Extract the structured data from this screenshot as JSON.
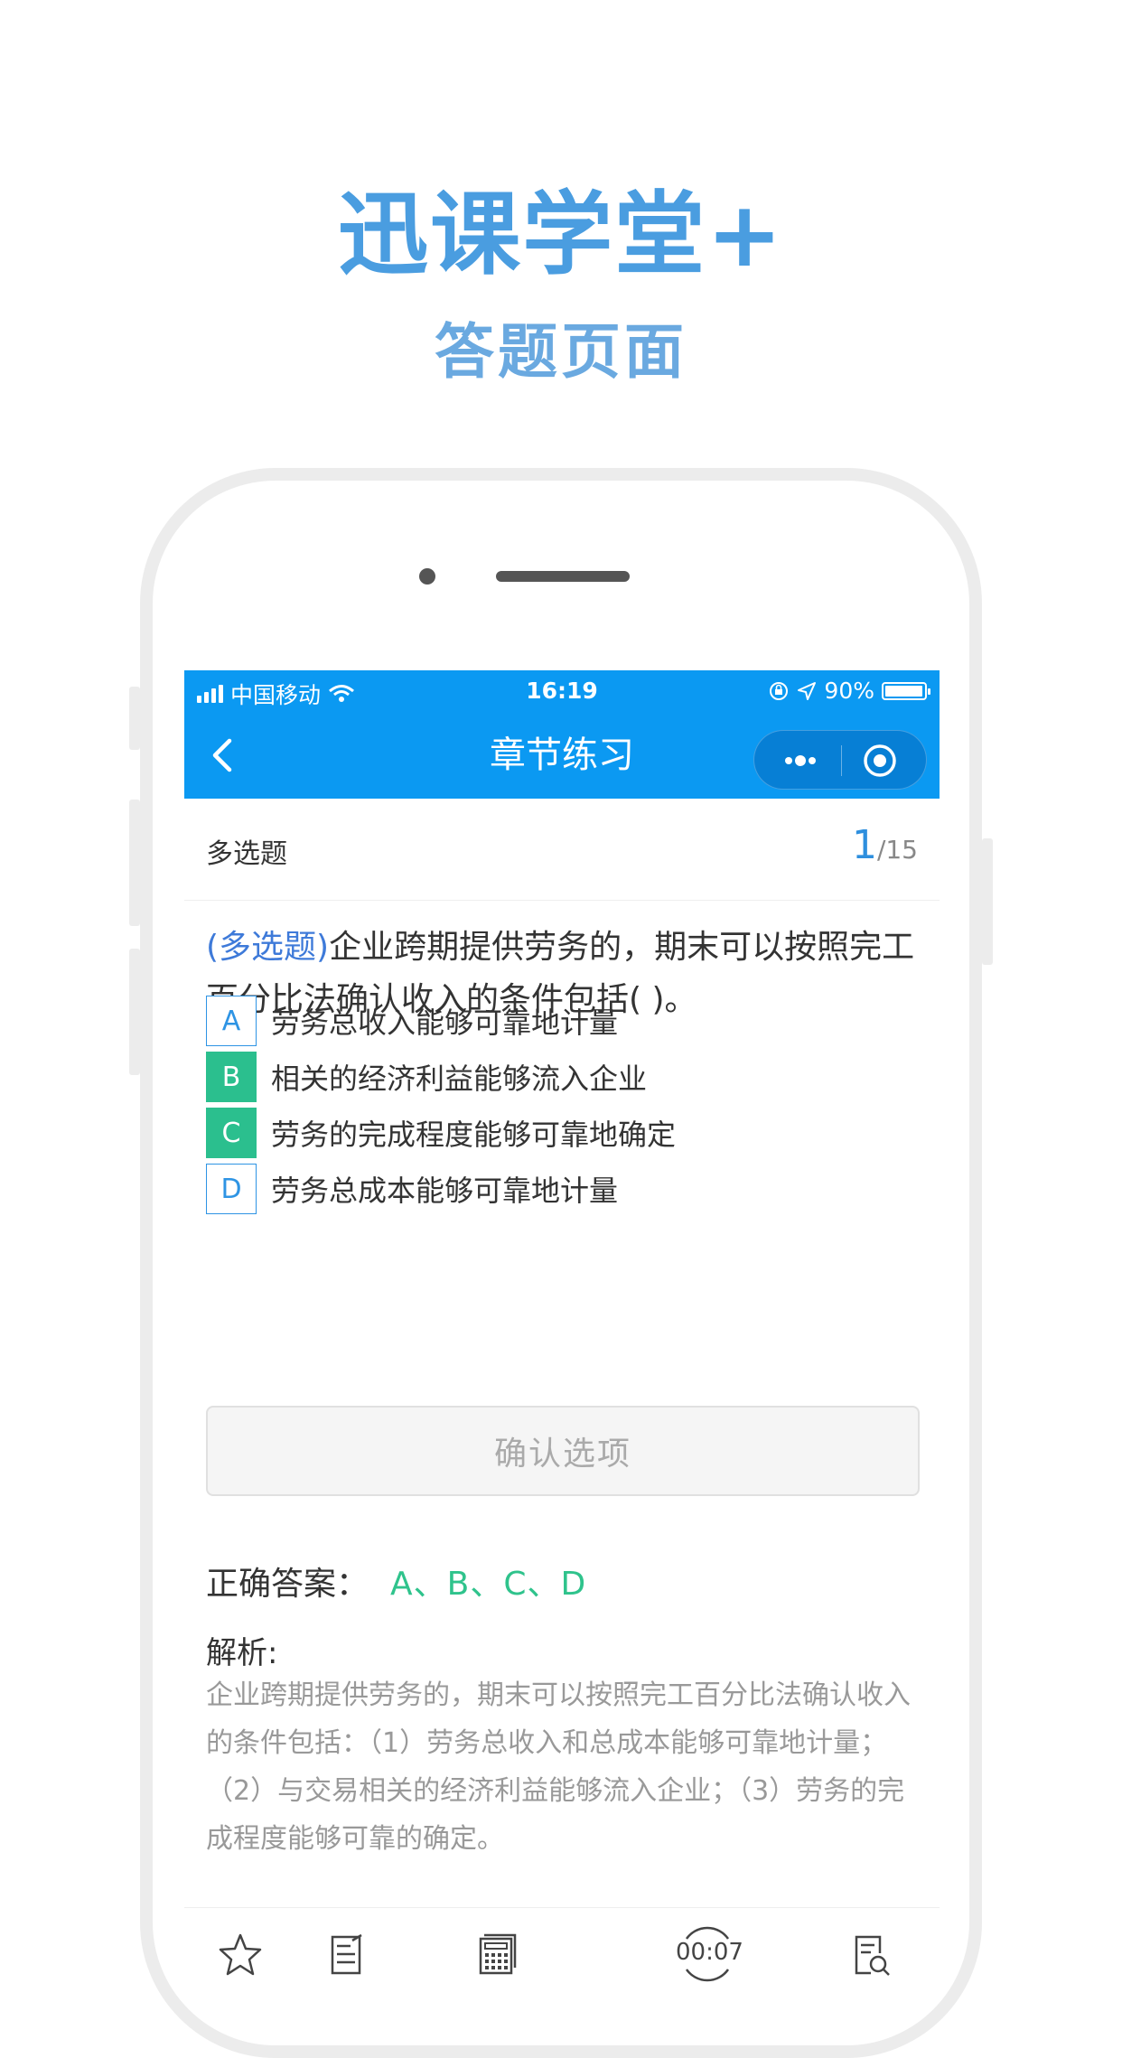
{
  "hero": {
    "title": "迅课学堂+",
    "subtitle": "答题页面"
  },
  "status_bar": {
    "carrier": "中国移动",
    "time": "16:19",
    "battery": "90%"
  },
  "nav": {
    "title": "章节练习"
  },
  "question_header": {
    "type": "多选题",
    "current": "1",
    "total": "/15"
  },
  "question": {
    "tag": "(多选题)",
    "text": "企业跨期提供劳务的，期末可以按照完工百分比法确认收入的条件包括( )。"
  },
  "options": [
    {
      "letter": "A",
      "text": "劳务总收入能够可靠地计量",
      "selected": false
    },
    {
      "letter": "B",
      "text": "相关的经济利益能够流入企业",
      "selected": true
    },
    {
      "letter": "C",
      "text": "劳务的完成程度能够可靠地确定",
      "selected": true
    },
    {
      "letter": "D",
      "text": "劳务总成本能够可靠地计量",
      "selected": false
    }
  ],
  "confirm_label": "确认选项",
  "answer": {
    "label": "正确答案：",
    "value": "A、B、C、D"
  },
  "analysis": {
    "title": "解析:",
    "text": "企业跨期提供劳务的，期末可以按照完工百分比法确认收入的条件包括：（1）劳务总收入和总成本能够可靠地计量；（2）与交易相关的经济利益能够流入企业；（3）劳务的完成程度能够可靠的确定。"
  },
  "toolbar": {
    "timer": "00:07"
  },
  "icons": [
    "signal-icon",
    "wifi-icon",
    "lock-rotation-icon",
    "location-icon",
    "battery-icon",
    "back-icon",
    "more-icon",
    "close-target-icon",
    "star-icon",
    "notes-icon",
    "calculator-icon",
    "timer-icon",
    "search-doc-icon"
  ],
  "colors": {
    "nav_blue": "#0b99f2",
    "selected_green": "#2bbf8e",
    "option_blue": "#2e94e4",
    "hero_blue": "#4a9de0"
  }
}
